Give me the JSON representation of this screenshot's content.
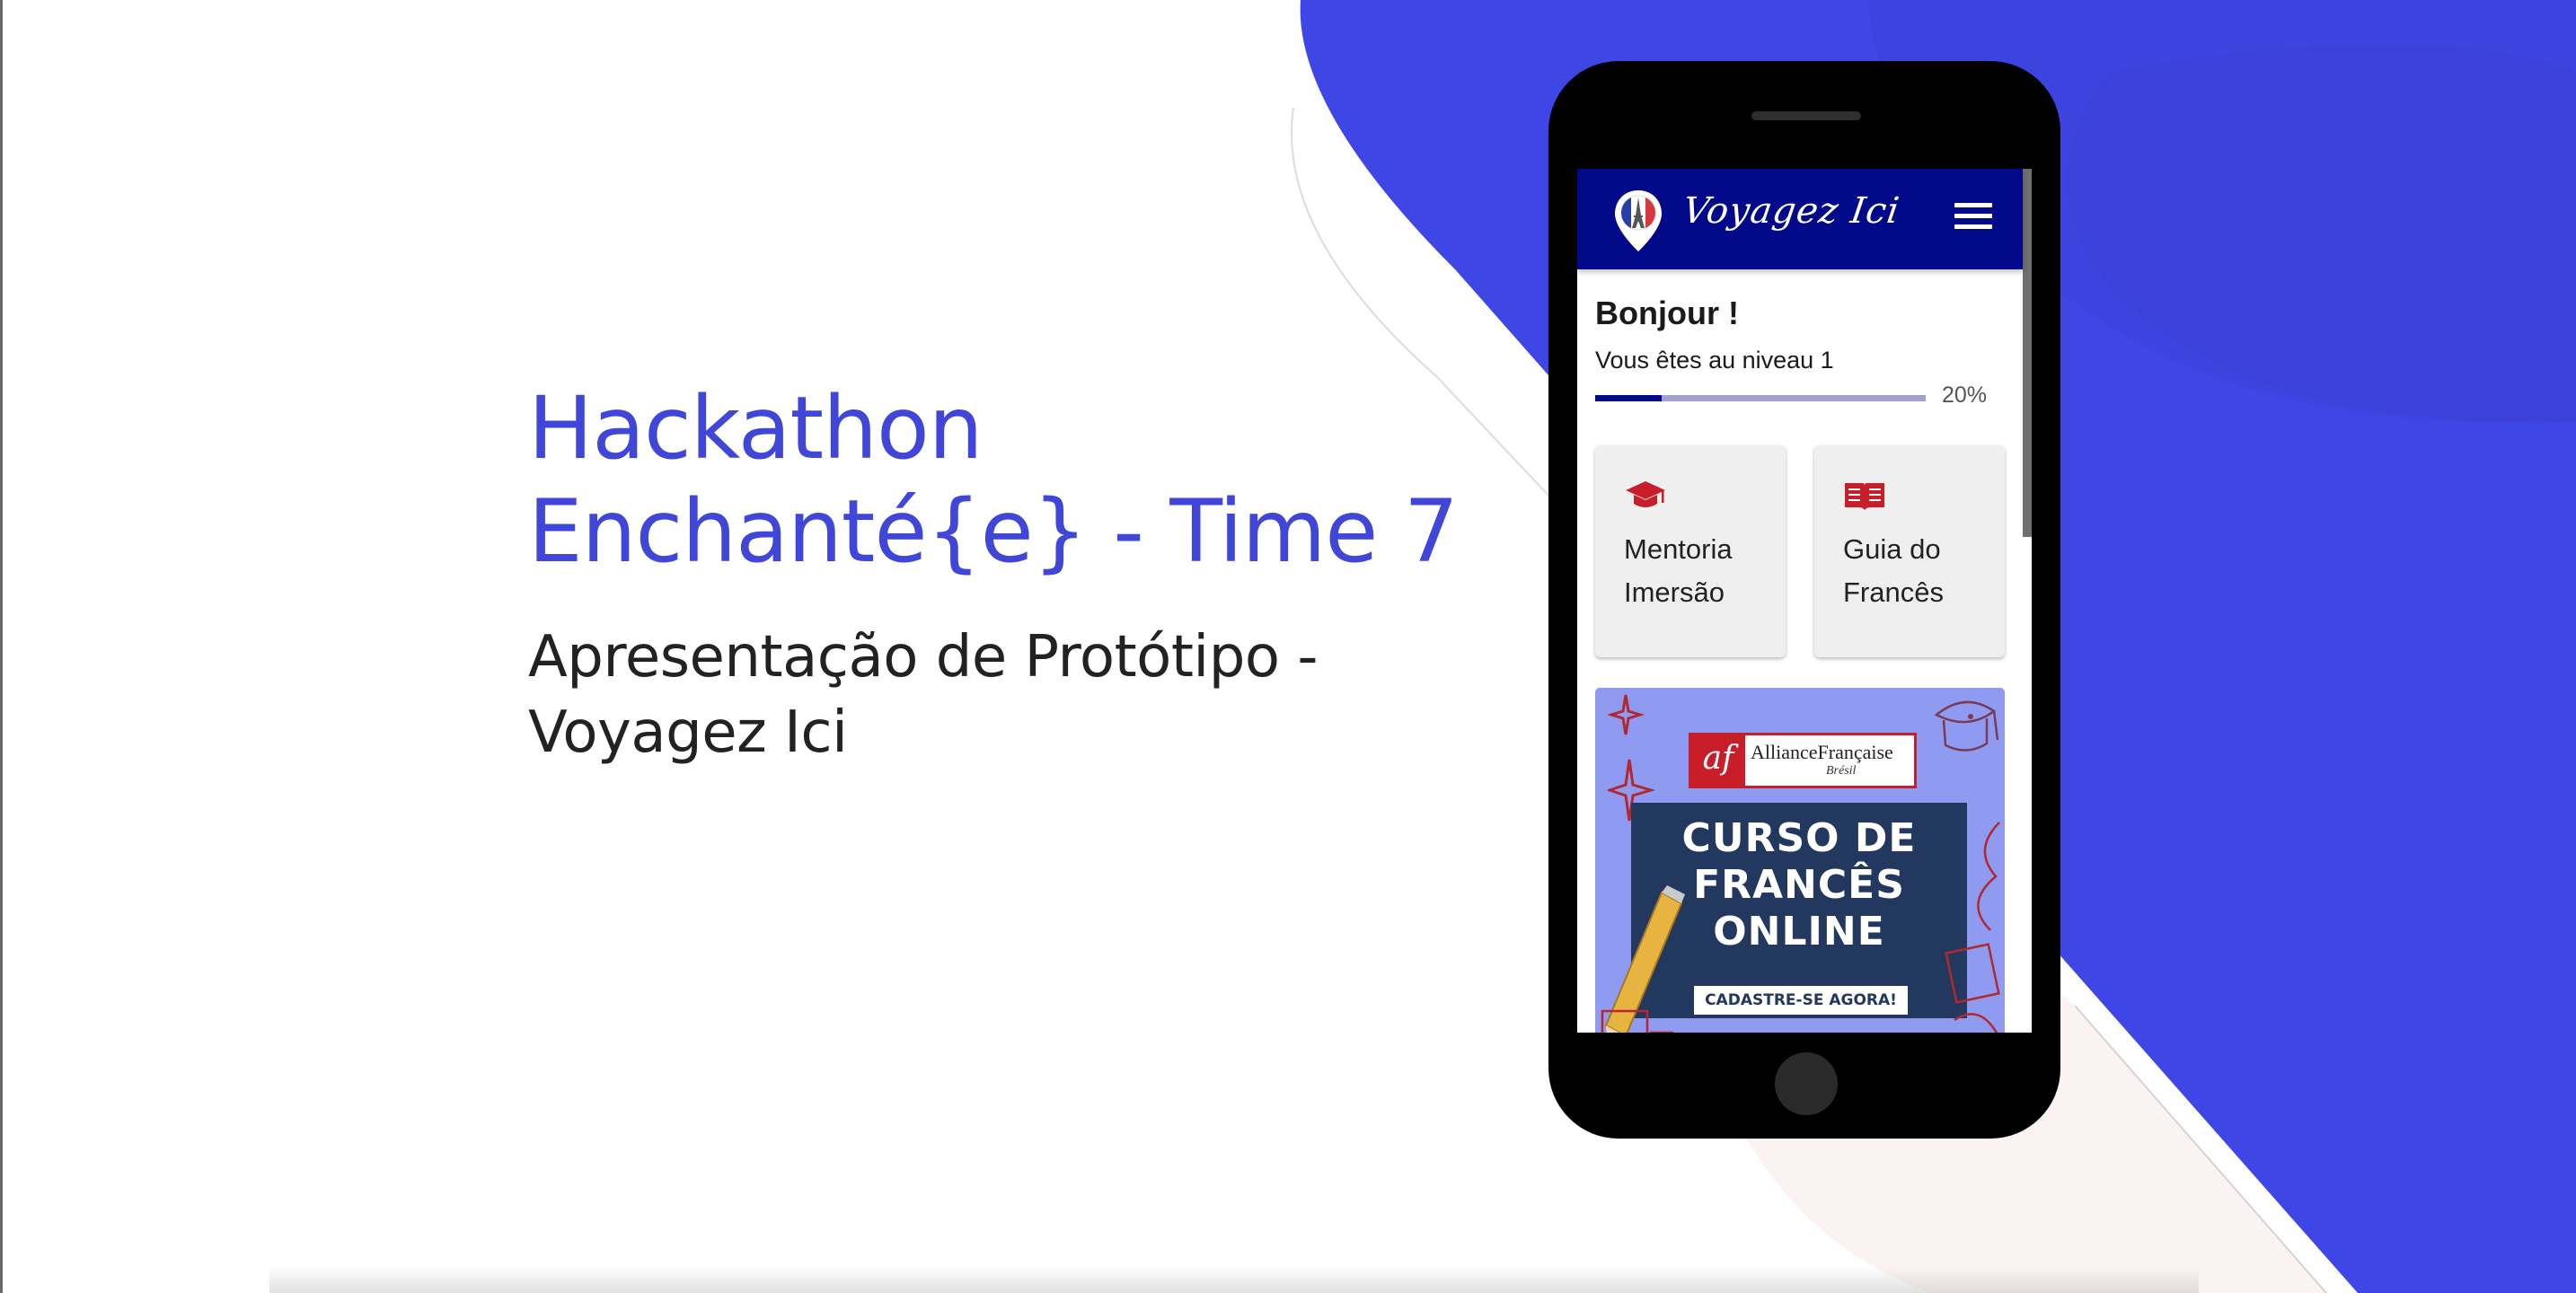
{
  "slide": {
    "title_lines": [
      "Hackathon",
      "Enchanté{e} - Time 7"
    ],
    "subtitle_lines": [
      "Apresentação de Protótipo -",
      "Voyagez Ici"
    ]
  },
  "colors": {
    "accent_blue": "#3f46d8",
    "app_navy": "#020a8a",
    "icon_red": "#c81e2a"
  },
  "app": {
    "brand": "Voyagez Ici",
    "logo_icon": "eiffel-tower-map-pin-icon",
    "menu_icon": "hamburger-menu-icon",
    "greeting": "Bonjour !",
    "level_text": "Vous êtes au niveau 1",
    "progress": {
      "value": 0.2,
      "label": "20%"
    },
    "cards": [
      {
        "icon": "graduation-cap-icon",
        "label_line1": "Mentoria",
        "label_line2": "Imersão"
      },
      {
        "icon": "open-book-icon",
        "label_line1": "Guia do",
        "label_line2": "Francês"
      }
    ],
    "banner": {
      "org_mark": "af",
      "org_name": "AllianceFrançaise",
      "org_country": "Brésil",
      "headline_lines": [
        "CURSO DE",
        "FRANCÊS",
        "ONLINE"
      ],
      "cta": "CADASTRE-SE AGORA!"
    }
  }
}
